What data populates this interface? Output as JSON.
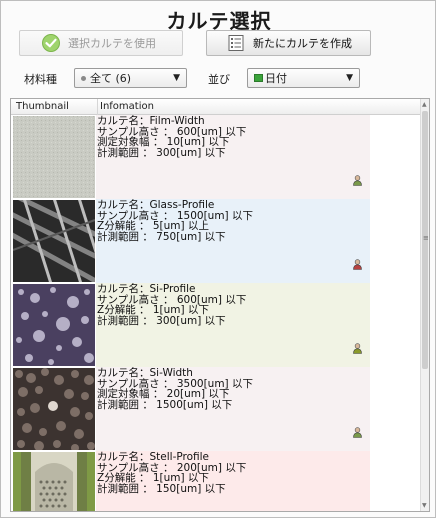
{
  "title": "カルテ選択",
  "toolbar": {
    "use_label": "選択カルテを使用",
    "new_label": "新たにカルテを作成"
  },
  "filter": {
    "material_label": "材料種",
    "material_value": "全て (6)",
    "sort_label": "並び",
    "sort_value": "日付"
  },
  "table": {
    "col_thumbnail": "Thumbnail",
    "col_information": "Infomation",
    "rows": [
      {
        "lines": [
          "カルテ名：Film-Width",
          "サンプル高さ ： 600[um] 以下",
          "測定対象幅 ： 10[um] 以下",
          "計測範囲 ： 300[um] 以下"
        ],
        "bg": "#f7f1f2",
        "user_color": "#7a9a4a",
        "thumb": "film"
      },
      {
        "lines": [
          "カルテ名：Glass-Profile",
          "サンプル高さ ： 1500[um] 以下",
          "Z分解能 ： 5[um] 以上",
          "計測範囲 ： 750[um] 以下"
        ],
        "bg": "#e8f1f9",
        "user_color": "#b8413f",
        "thumb": "glass"
      },
      {
        "lines": [
          "カルテ名：Si-Profile",
          "サンプル高さ ： 600[um] 以下",
          "Z分解能 ： 1[um] 以下",
          "計測範囲 ： 300[um] 以下"
        ],
        "bg": "#f1f3e4",
        "user_color": "#8a9a2a",
        "thumb": "siprofile"
      },
      {
        "lines": [
          "カルテ名：Si-Width",
          "サンプル高さ ： 3500[um] 以下",
          "測定対象幅 ： 20[um] 以下",
          "計測範囲 ： 1500[um] 以下"
        ],
        "bg": "#f7f1f2",
        "user_color": "#7a9a4a",
        "thumb": "siwidth"
      },
      {
        "lines": [
          "カルテ名：Stell-Profile",
          "サンプル高さ ： 200[um] 以下",
          "Z分解能 ： 1[um] 以下",
          "計測範囲 ： 150[um] 以下"
        ],
        "bg": "#fdeaea",
        "user_color": "#b8413f",
        "thumb": "stell"
      }
    ]
  },
  "colors": {
    "check_green": "#7cc24a",
    "sort_icon_green": "#3aa33a"
  }
}
